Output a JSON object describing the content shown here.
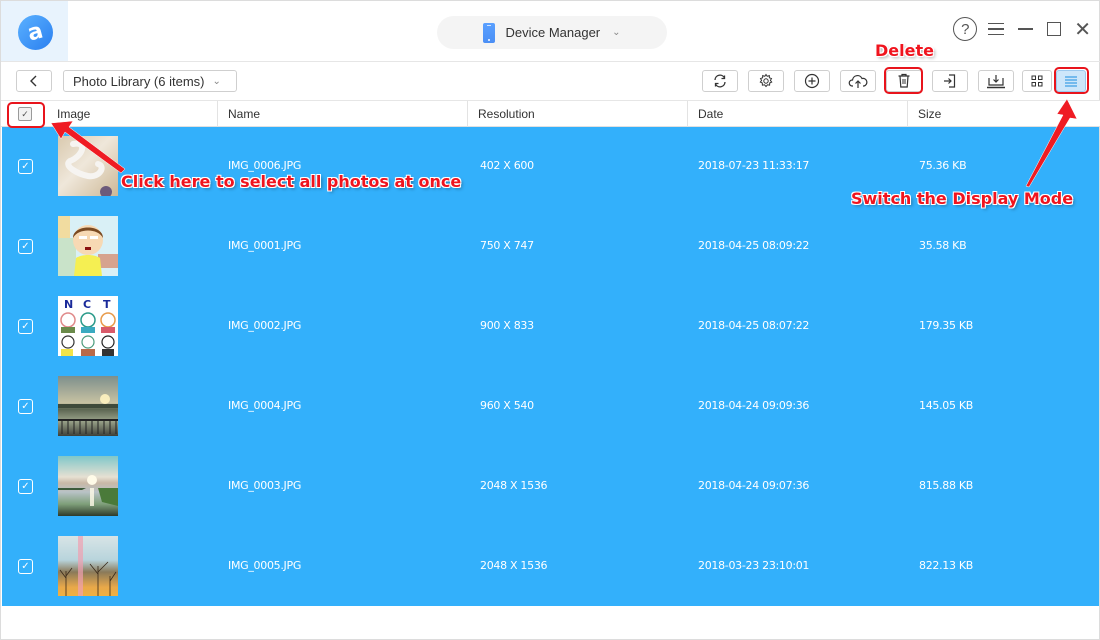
{
  "titlebar": {
    "logo_glyph": "a",
    "device_selector": {
      "label": "Device Manager",
      "icon": "phone-icon",
      "chevron": "⌄"
    },
    "window_controls": {
      "help": "?",
      "menu": "menu-icon",
      "minimize": "minimize-icon",
      "maximize": "maximize-icon",
      "close": "✕"
    }
  },
  "toolbar": {
    "back_label": "‹",
    "library_select": {
      "value": "Photo Library (6 items)",
      "chevron": "⌄"
    },
    "buttons": [
      {
        "name": "refresh",
        "icon": "refresh-icon"
      },
      {
        "name": "settings",
        "icon": "gear-icon"
      },
      {
        "name": "add",
        "icon": "plus-circle-icon"
      },
      {
        "name": "upload-to-cloud",
        "icon": "cloud-upload-icon"
      },
      {
        "name": "delete",
        "icon": "trash-icon"
      },
      {
        "name": "export-to-computer",
        "icon": "export-icon"
      },
      {
        "name": "send-to-device",
        "icon": "download-tray-icon"
      },
      {
        "name": "grid-view",
        "icon": "grid-icon"
      },
      {
        "name": "list-view",
        "icon": "list-icon",
        "active": true
      }
    ]
  },
  "table": {
    "select_all_checked": true,
    "columns": [
      "Image",
      "Name",
      "Resolution",
      "Date",
      "Size"
    ],
    "rows": [
      {
        "checked": true,
        "name": "IMG_0006.JPG",
        "resolution": "402 X 600",
        "date": "2018-07-23 11:33:17",
        "size": "75.36 KB",
        "thumb": "sand-writing"
      },
      {
        "checked": true,
        "name": "IMG_0001.JPG",
        "resolution": "750 X 747",
        "date": "2018-04-25 08:09:22",
        "size": "35.58 KB",
        "thumb": "cartoon-boy"
      },
      {
        "checked": true,
        "name": "IMG_0002.JPG",
        "resolution": "900 X 833",
        "date": "2018-04-25 08:07:22",
        "size": "179.35 KB",
        "thumb": "nct-drawing"
      },
      {
        "checked": true,
        "name": "IMG_0004.JPG",
        "resolution": "960 X 540",
        "date": "2018-04-24 09:09:36",
        "size": "145.05 KB",
        "thumb": "sunset-pier"
      },
      {
        "checked": true,
        "name": "IMG_0003.JPG",
        "resolution": "2048 X 1536",
        "date": "2018-04-24 09:07:36",
        "size": "815.88 KB",
        "thumb": "sun-over-lake"
      },
      {
        "checked": true,
        "name": "IMG_0005.JPG",
        "resolution": "2048 X 1536",
        "date": "2018-03-23 23:10:01",
        "size": "822.13 KB",
        "thumb": "trees-sunrise"
      }
    ],
    "selection_color": "#33b0fb"
  },
  "annotations": {
    "delete_label": "Delete",
    "select_all_label": "Click here to select all photos at once",
    "display_mode_label": "Switch the Display Mode",
    "color": "#f0141e"
  }
}
